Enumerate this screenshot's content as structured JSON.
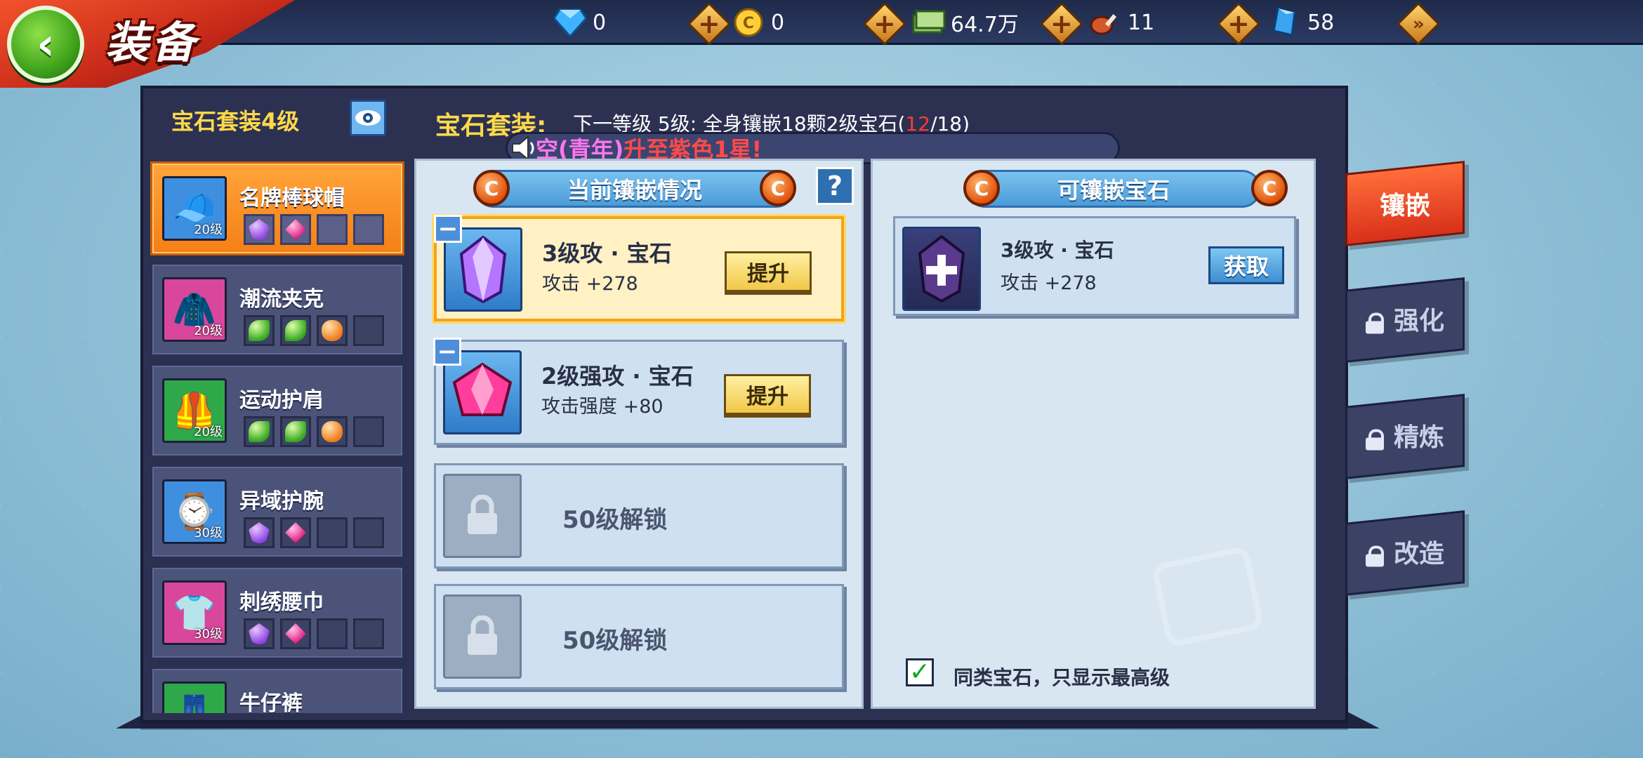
{
  "title": "装备",
  "currencies": [
    {
      "icon": "diamond-icon",
      "value": "0"
    },
    {
      "icon": "gold-coin-icon",
      "value": "0"
    },
    {
      "icon": "cash-icon",
      "value": "64.7万"
    },
    {
      "icon": "meat-icon",
      "value": "11"
    },
    {
      "icon": "crystal-icon",
      "value": "58"
    }
  ],
  "header": {
    "set_level_label": "宝石套装4级",
    "set_title": "宝石套装:",
    "next_prefix": "下一等级  5级: 全身镶嵌18颗2级宝石(",
    "progress_current": "12",
    "progress_suffix": "/18)"
  },
  "marquee": {
    "part1": "空(青年)",
    "part2": "升至",
    "part3": "紫色1星!"
  },
  "equipment": [
    {
      "name": "名牌棒球帽",
      "level": "20级",
      "icon": "baseball-cap-icon",
      "color": "#3f8fe0",
      "gems": [
        "purple",
        "pink",
        "",
        ""
      ]
    },
    {
      "name": "潮流夹克",
      "level": "20级",
      "icon": "jacket-icon",
      "color": "#d8479b",
      "gems": [
        "green",
        "green",
        "orange",
        ""
      ]
    },
    {
      "name": "运动护肩",
      "level": "20级",
      "icon": "shoulder-pad-icon",
      "color": "#2fa84a",
      "gems": [
        "green",
        "green",
        "orange",
        ""
      ]
    },
    {
      "name": "异域护腕",
      "level": "30级",
      "icon": "wristband-icon",
      "color": "#3f8fe0",
      "gems": [
        "purple",
        "pink",
        "",
        ""
      ]
    },
    {
      "name": "刺绣腰巾",
      "level": "30级",
      "icon": "waist-scarf-icon",
      "color": "#d8479b",
      "gems": [
        "purple",
        "pink",
        "",
        ""
      ]
    },
    {
      "name": "牛仔裤",
      "level": "",
      "icon": "jeans-icon",
      "color": "#2fa84a",
      "gems": []
    }
  ],
  "current": {
    "title": "当前镶嵌情况",
    "help": "?",
    "slots": [
      {
        "name": "3级攻 · 宝石",
        "stat": "攻击 +278",
        "button": "提升",
        "gem": "purple"
      },
      {
        "name": "2级强攻 · 宝石",
        "stat": "攻击强度 +80",
        "button": "提升",
        "gem": "pink"
      },
      {
        "locked": "50级解锁"
      },
      {
        "locked": "50级解锁"
      }
    ]
  },
  "available": {
    "title": "可镶嵌宝石",
    "gems": [
      {
        "name": "3级攻 · 宝石",
        "stat": "攻击 +278",
        "button": "获取"
      }
    ],
    "filter_label": "同类宝石，只显示最高级"
  },
  "tabs": [
    {
      "label": "镶嵌",
      "active": true
    },
    {
      "label": "强化",
      "locked": true
    },
    {
      "label": "精炼",
      "locked": true
    },
    {
      "label": "改造",
      "locked": true
    }
  ]
}
